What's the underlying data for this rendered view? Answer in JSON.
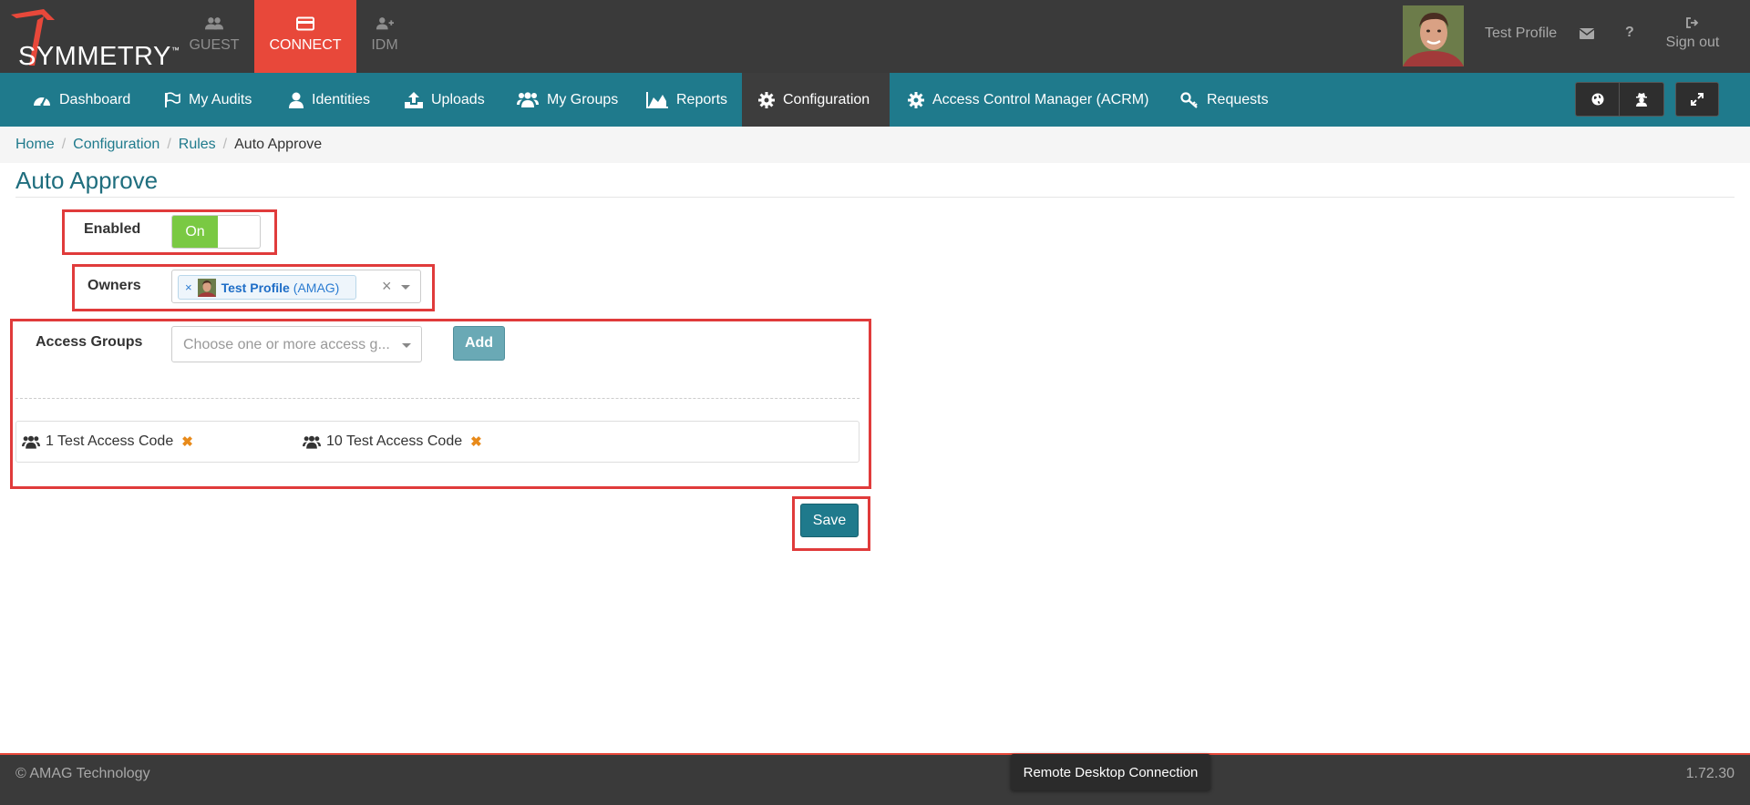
{
  "colors": {
    "topbar": "#3a3a3a",
    "accent_red": "#e8483a",
    "nav_teal": "#1f7a8c",
    "toggle_on": "#7ac943",
    "highlight": "#e03b3b",
    "remove_orange": "#e88a1a"
  },
  "header": {
    "brand": "SYMMETRY",
    "brand_tm": "™",
    "apps": [
      {
        "label": "GUEST",
        "icon": "users-icon"
      },
      {
        "label": "CONNECT",
        "icon": "credit-card-icon",
        "active": true
      },
      {
        "label": "IDM",
        "icon": "user-plus-icon"
      }
    ],
    "profile_name": "Test Profile",
    "signout_label": "Sign out",
    "help_label": "?"
  },
  "nav": {
    "items": [
      {
        "label": "Dashboard",
        "icon": "dashboard-icon"
      },
      {
        "label": "My Audits",
        "icon": "flag-icon"
      },
      {
        "label": "Identities",
        "icon": "user-icon"
      },
      {
        "label": "Uploads",
        "icon": "upload-icon"
      },
      {
        "label": "My Groups",
        "icon": "users-icon"
      },
      {
        "label": "Reports",
        "icon": "area-chart-icon"
      },
      {
        "label": "Configuration",
        "icon": "gear-icon",
        "active": true
      },
      {
        "label": "Access Control Manager (ACRM)",
        "icon": "gear-icon"
      },
      {
        "label": "Requests",
        "icon": "key-icon"
      }
    ]
  },
  "breadcrumb": {
    "items": [
      "Home",
      "Configuration",
      "Rules"
    ],
    "current": "Auto Approve"
  },
  "page": {
    "title": "Auto Approve"
  },
  "form": {
    "enabled": {
      "label": "Enabled",
      "value": "On"
    },
    "owners": {
      "label": "Owners",
      "selected": [
        {
          "name": "Test Profile",
          "org": "(AMAG)",
          "remove": "×"
        }
      ],
      "clear": "×"
    },
    "access_groups": {
      "label": "Access Groups",
      "placeholder": "Choose one or more access g...",
      "add_label": "Add",
      "items": [
        {
          "name": "1 Test Access Code",
          "remove": "✖"
        },
        {
          "name": "10 Test Access Code",
          "remove": "✖"
        }
      ]
    },
    "save_label": "Save"
  },
  "footer": {
    "copyright": "© AMAG Technology",
    "version": "1.72.30",
    "tooltip": "Remote Desktop Connection"
  }
}
